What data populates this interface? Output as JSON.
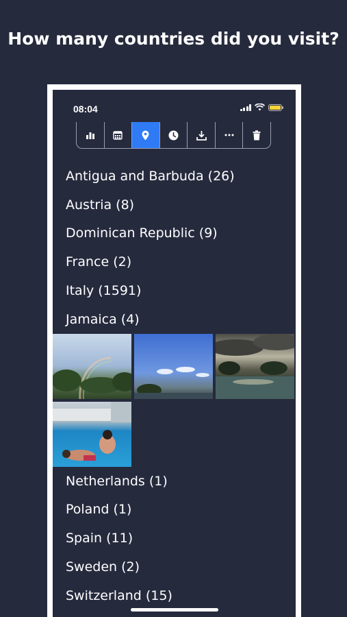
{
  "headline": "How many countries did you visit?",
  "status_bar": {
    "time": "08:04"
  },
  "toolbar": {
    "tools": [
      {
        "icon": "bar-chart-icon",
        "active": false
      },
      {
        "icon": "calendar-icon",
        "active": false
      },
      {
        "icon": "location-pin-icon",
        "active": true
      },
      {
        "icon": "clock-icon",
        "active": false
      },
      {
        "icon": "download-icon",
        "active": false
      },
      {
        "icon": "more-icon",
        "active": false
      },
      {
        "icon": "trash-icon",
        "active": false
      }
    ],
    "active_color": "#2f7bf5"
  },
  "countries": [
    "Antigua and Barbuda (26)",
    "Austria (8)",
    "Dominican Republic (9)",
    "France (2)",
    "Italy (1591)",
    "Jamaica (4)",
    "Netherlands (1)",
    "Poland (1)",
    "Spain (11)",
    "Sweden (2)",
    "Switzerland (15)"
  ],
  "colors": {
    "background": "#262a3d",
    "battery": "#f5d43a"
  }
}
